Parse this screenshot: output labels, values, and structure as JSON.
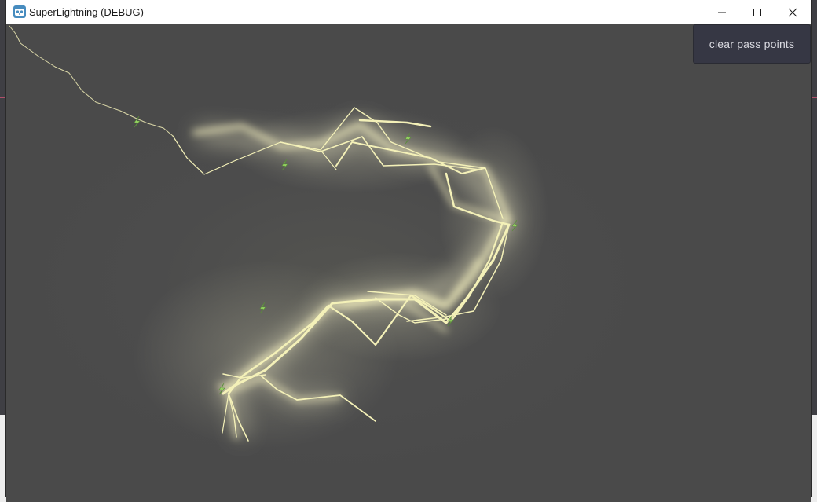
{
  "window": {
    "title": "SuperLightning (DEBUG)",
    "app_icon": "godot-icon",
    "controls": [
      "minimize-icon",
      "maximize-icon",
      "close-icon"
    ]
  },
  "scene": {
    "clear_button_label": "clear pass points",
    "pass_point_icon": "lightning-bolt-icon",
    "pass_point_count": 7,
    "bolt_color": "#f4f1b8",
    "glow_color": "#fffbd2",
    "marker_color": "#9fe06a",
    "background_color": "#4a4a4a"
  }
}
